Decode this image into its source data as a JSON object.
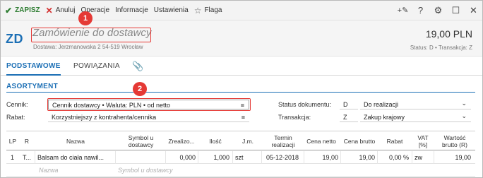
{
  "toolbar": {
    "save_label": "ZAPISZ",
    "cancel_label": "Anuluj",
    "operations_label": "Operacje",
    "info_label": "Informacje",
    "settings_label": "Ustawienia",
    "flag_label": "Flaga",
    "save_icon": "✔",
    "cancel_icon": "✕",
    "flag_icon": "☆",
    "right_icons": [
      "+✎",
      "?",
      "⚙",
      "☐",
      "✕"
    ]
  },
  "header": {
    "doc_code": "ZD",
    "title": "Zamówienie do dostawcy",
    "subtitle": "Dostawa: Jerzmanowska 2 54-519 Wrocław",
    "amount": "19,00 PLN",
    "status": "Status: D  •  Transakcja: Z"
  },
  "tabs": {
    "basic": "PODSTAWOWE",
    "links": "POWIĄZANIA",
    "attach_icon": "📎"
  },
  "section": {
    "title": "ASORTYMENT"
  },
  "form": {
    "pricelist_label": "Cennik:",
    "pricelist_value": "Cennik dostawcy • Waluta: PLN • od netto",
    "discount_label": "Rabat:",
    "discount_value": "Korzystniejszy z kontrahenta/cennika",
    "menu_icon": "≡",
    "doc_status_label": "Status dokumentu:",
    "doc_status_code": "D",
    "doc_status_value": "Do realizacji",
    "transaction_label": "Transakcja:",
    "transaction_code": "Z",
    "transaction_value": "Zakup krajowy",
    "dropdown_icon": "⌄"
  },
  "table": {
    "headers": {
      "lp": "LP",
      "r": "R",
      "name": "Nazwa",
      "symbol": "Symbol u dostawcy",
      "realized": "Zrealizo...",
      "qty": "Ilość",
      "unit": "J.m.",
      "date": "Termin realizacji",
      "net_price": "Cena netto",
      "gross_price": "Cena brutto",
      "discount": "Rabat",
      "vat": "VAT [%]",
      "gross_value": "Wartość brutto (R)"
    },
    "row1": {
      "lp": "1",
      "r": "T...",
      "name": "Balsam do ciała nawil...",
      "symbol": "",
      "realized": "0,000",
      "qty": "1,000",
      "unit": "szt",
      "date": "05-12-2018",
      "net_price": "19,00",
      "gross_price": "19,00",
      "discount": "0,00 %",
      "vat": "zw",
      "gross_value": "19,00"
    },
    "new_row": {
      "name_placeholder": "Nazwa",
      "symbol_placeholder": "Symbol u dostawcy"
    }
  },
  "callouts": {
    "one": "1",
    "two": "2",
    "color": "#e53935"
  },
  "colors": {
    "accent": "#1c6fb5",
    "save": "#2e7d32",
    "cancel": "#d32f2f"
  }
}
